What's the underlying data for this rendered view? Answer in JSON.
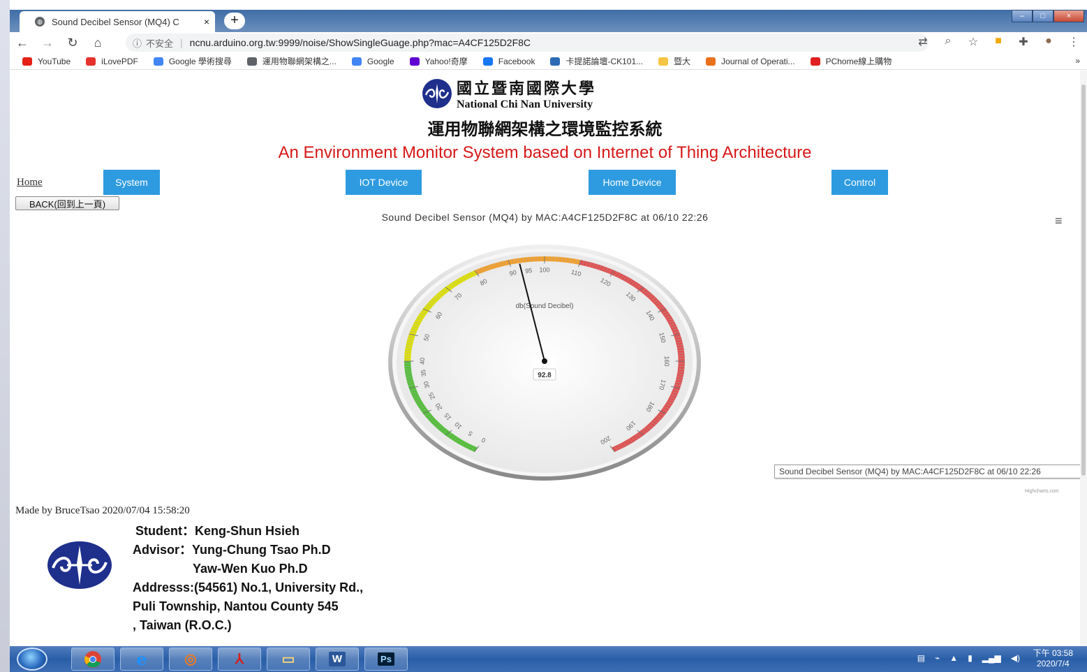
{
  "browser": {
    "tab_title": "Sound Decibel Sensor (MQ4) C",
    "tab_close": "×",
    "new_tab": "+",
    "address": {
      "security_label": "不安全",
      "url": "ncnu.arduino.org.tw:9999/noise/ShowSingleGuage.php?mac=A4CF125D2F8C"
    },
    "window_controls": [
      "–",
      "□",
      "×"
    ]
  },
  "bookmarks": [
    {
      "label": "YouTube",
      "icon": "youtube-icon",
      "color": "#e62117"
    },
    {
      "label": "iLovePDF",
      "icon": "heart-icon",
      "color": "#e5322d"
    },
    {
      "label": "Google 學術搜尋",
      "icon": "scholar-cap-icon",
      "color": "#4285f4"
    },
    {
      "label": "運用物聯網架構之...",
      "icon": "globe-icon",
      "color": "#5f6368"
    },
    {
      "label": "Google",
      "icon": "google-g-icon",
      "color": "#4285f4"
    },
    {
      "label": "Yahoo!奇摩",
      "icon": "yahoo-icon",
      "color": "#6001d2"
    },
    {
      "label": "Facebook",
      "icon": "facebook-icon",
      "color": "#1877f2"
    },
    {
      "label": "卡提諾論壇-CK101...",
      "icon": "forum-icon",
      "color": "#2d6bb5"
    },
    {
      "label": "暨大",
      "icon": "folder-icon",
      "color": "#f4c542"
    },
    {
      "label": "Journal of Operati...",
      "icon": "elsevier-e-icon",
      "color": "#e9711c"
    },
    {
      "label": "PChome線上購物",
      "icon": "pchome-icon",
      "color": "#e02020"
    }
  ],
  "bookmarks_more": "»",
  "page": {
    "university_cn": "國立暨南國際大學",
    "university_en": "National Chi Nan University",
    "system_title_cn": "運用物聯網架構之環境監控系統",
    "system_title_en": "An Environment Monitor System based on Internet of Thing Architecture",
    "home_link": "Home",
    "nav": {
      "system": "System",
      "iot_device": "IOT Device",
      "home_device": "Home Device",
      "control": "Control"
    },
    "back_button": "BACK(回到上一頁)",
    "made_by": "Made by BruceTsao 2020/07/04 15:58:20",
    "footer": {
      "student": "Student：Keng-Shun Hsieh",
      "advisor_1": "Advisor：Yung-Chung Tsao Ph.D",
      "advisor_2": "Yaw-Wen Kuo  Ph.D",
      "address_1": "Addresss:(54561) No.1, University Rd.,",
      "address_2": "Puli Township, Nantou County 545",
      "address_3": ", Taiwan (R.O.C.)"
    }
  },
  "chart_data": {
    "type": "gauge",
    "title": "Sound Decibel Sensor (MQ4) by MAC:A4CF125D2F8C at 06/10 22:26",
    "pane_label": "db(Sound Decibel)",
    "value": 92.8,
    "value_label": "92.8",
    "min": 0,
    "max": 200,
    "start_angle": -150,
    "end_angle": 150,
    "tick_labels": [
      0,
      5,
      10,
      15,
      20,
      25,
      30,
      35,
      40,
      50,
      60,
      70,
      80,
      90,
      95,
      100,
      110,
      120,
      130,
      140,
      150,
      160,
      170,
      180,
      190,
      200
    ],
    "bands": [
      {
        "from": 0,
        "to": 40,
        "color": "#55BF3B"
      },
      {
        "from": 40,
        "to": 80,
        "color": "#DDDF0D"
      },
      {
        "from": 80,
        "to": 110,
        "color": "#F0A030"
      },
      {
        "from": 110,
        "to": 200,
        "color": "#DF5353"
      }
    ],
    "tooltip": "Sound Decibel Sensor (MQ4) by MAC:A4CF125D2F8C at 06/10  22:26",
    "credits": "Highcharts.com",
    "menu_icon": "hamburger-menu-icon"
  },
  "taskbar": {
    "apps": [
      {
        "name": "chrome",
        "icon": "chrome-icon"
      },
      {
        "name": "ie",
        "icon": "internet-explorer-icon",
        "glyph": "e"
      },
      {
        "name": "media",
        "icon": "media-player-icon",
        "glyph": "◎"
      },
      {
        "name": "pdf",
        "icon": "acrobat-icon",
        "glyph": "⅄"
      },
      {
        "name": "explorer",
        "icon": "folder-icon",
        "glyph": "▭"
      },
      {
        "name": "word",
        "icon": "word-icon",
        "glyph": "W"
      },
      {
        "name": "photoshop",
        "icon": "photoshop-icon",
        "glyph": "Ps"
      }
    ],
    "clock_time": "下午 03:58",
    "clock_date": "2020/7/4"
  }
}
